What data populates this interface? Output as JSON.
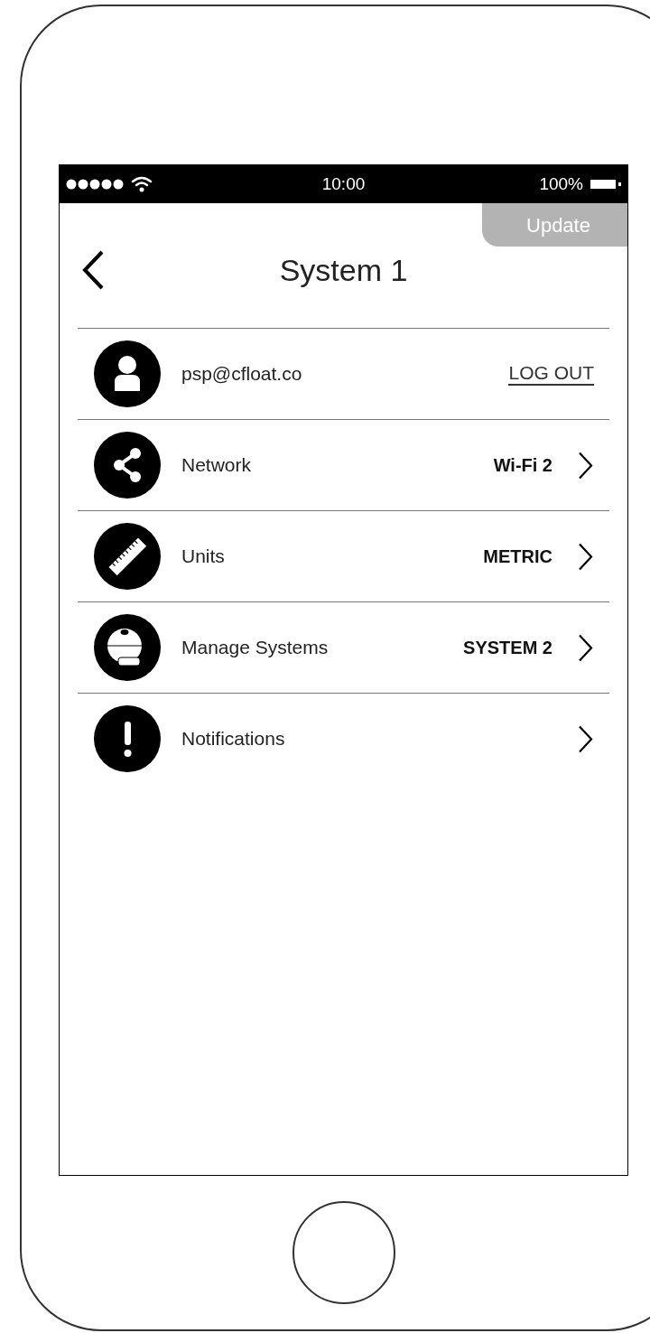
{
  "status_bar": {
    "time": "10:00",
    "battery": "100%"
  },
  "update_button": {
    "label": "Update"
  },
  "header": {
    "title": "System 1"
  },
  "settings": [
    {
      "kind": "account",
      "label": "psp@cfloat.co",
      "action": "LOG OUT"
    },
    {
      "kind": "nav",
      "label": "Network",
      "value": "Wi-Fi 2"
    },
    {
      "kind": "nav",
      "label": "Units",
      "value": "METRIC"
    },
    {
      "kind": "nav",
      "label": "Manage Systems",
      "value": "SYSTEM 2"
    },
    {
      "kind": "nav",
      "label": "Notifications"
    }
  ]
}
